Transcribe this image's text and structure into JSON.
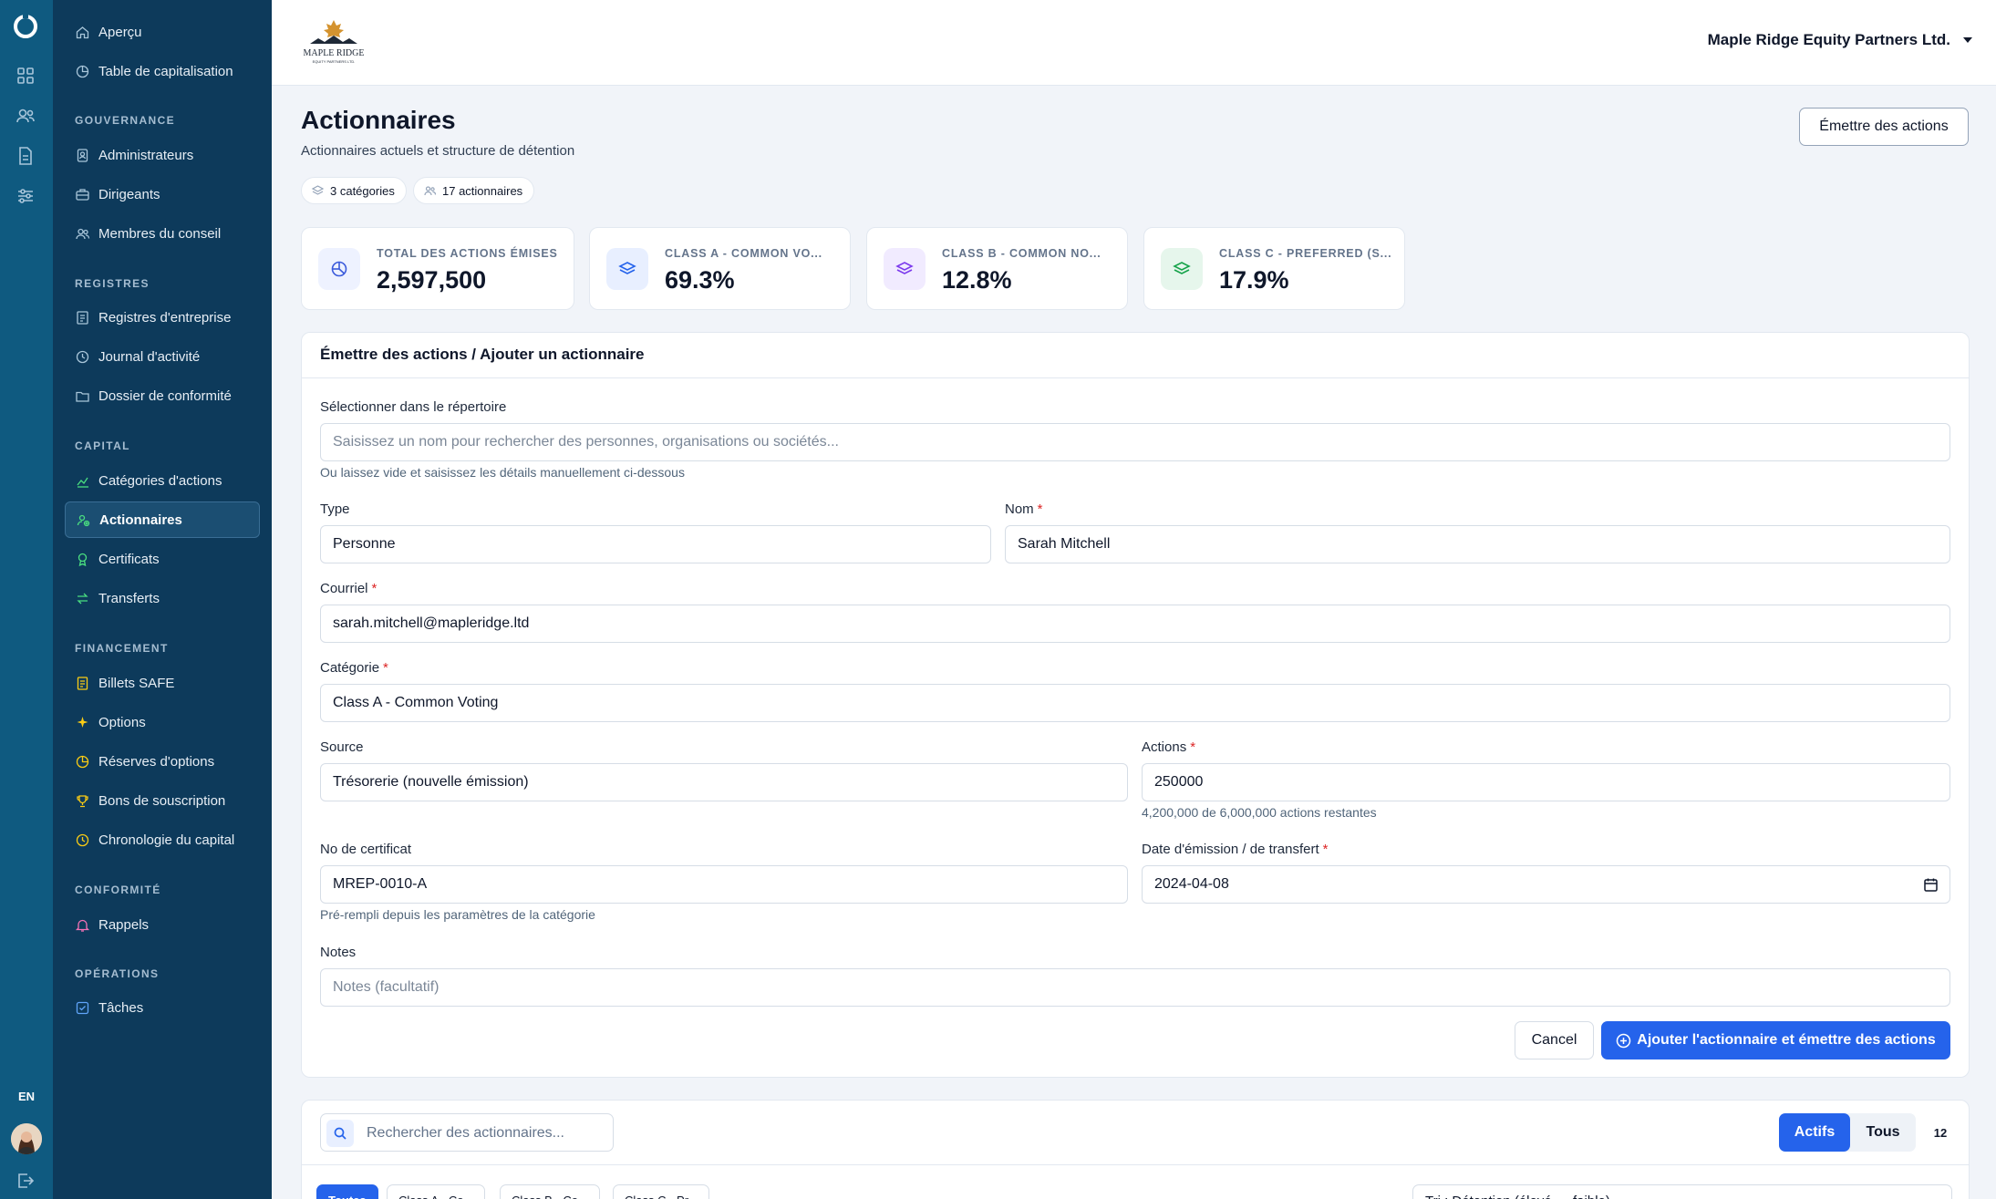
{
  "rail": {
    "lang": "EN",
    "icons": [
      "logo-icon",
      "grid-icon",
      "users-icon",
      "document-icon",
      "sliders-icon",
      "logout-icon"
    ]
  },
  "sidebar": {
    "top": [
      {
        "label": "Aperçu",
        "icon": "home-icon"
      },
      {
        "label": "Table de capitalisation",
        "icon": "pie-icon"
      }
    ],
    "sections": [
      {
        "heading": "GOUVERNANCE",
        "items": [
          {
            "label": "Administrateurs",
            "icon": "badge-icon"
          },
          {
            "label": "Dirigeants",
            "icon": "briefcase-icon"
          },
          {
            "label": "Membres du conseil",
            "icon": "group-icon"
          }
        ]
      },
      {
        "heading": "REGISTRES",
        "items": [
          {
            "label": "Registres d'entreprise",
            "icon": "register-icon"
          },
          {
            "label": "Journal d'activité",
            "icon": "clock-icon"
          },
          {
            "label": "Dossier de conformité",
            "icon": "folder-icon"
          }
        ]
      },
      {
        "heading": "CAPITAL",
        "items": [
          {
            "label": "Catégories d'actions",
            "icon": "chart-icon"
          },
          {
            "label": "Actionnaires",
            "icon": "shareholders-icon",
            "active": true
          },
          {
            "label": "Certificats",
            "icon": "award-icon"
          },
          {
            "label": "Transferts",
            "icon": "transfer-icon"
          }
        ]
      },
      {
        "heading": "FINANCEMENT",
        "items": [
          {
            "label": "Billets SAFE",
            "icon": "note-icon"
          },
          {
            "label": "Options",
            "icon": "sparkle-icon"
          },
          {
            "label": "Réserves d'options",
            "icon": "pie-icon"
          },
          {
            "label": "Bons de souscription",
            "icon": "trophy-icon"
          },
          {
            "label": "Chronologie du capital",
            "icon": "clock-icon"
          }
        ]
      },
      {
        "heading": "CONFORMITÉ",
        "items": [
          {
            "label": "Rappels",
            "icon": "bell-icon"
          }
        ]
      },
      {
        "heading": "OPÉRATIONS",
        "items": [
          {
            "label": "Tâches",
            "icon": "checkbox-icon"
          }
        ]
      }
    ]
  },
  "topbar": {
    "logo_text": "MAPLE RIDGE",
    "logo_subtext": "EQUITY PARTNERS LTD.",
    "org_name": "Maple Ridge Equity Partners Ltd."
  },
  "page": {
    "title": "Actionnaires",
    "subtitle": "Actionnaires actuels et structure de détention",
    "pills": [
      "3 catégories",
      "17 actionnaires"
    ],
    "emit_button": "Émettre des actions"
  },
  "stats": [
    {
      "label": "TOTAL DES ACTIONS ÉMISES",
      "value": "2,597,500",
      "color": "#3b5bdb",
      "bg": "#eef2ff"
    },
    {
      "label": "CLASS A - COMMON VO...",
      "value": "69.3%",
      "color": "#2563eb",
      "bg": "#e8efff"
    },
    {
      "label": "CLASS B - COMMON NO...",
      "value": "12.8%",
      "color": "#7c3aed",
      "bg": "#f1ebff"
    },
    {
      "label": "CLASS C - PREFERRED (S...",
      "value": "17.9%",
      "color": "#16a34a",
      "bg": "#e6f6ec"
    }
  ],
  "form": {
    "heading": "Émettre des actions / Ajouter un actionnaire",
    "directory_label": "Sélectionner dans le répertoire",
    "directory_placeholder": "Saisissez un nom pour rechercher des personnes, organisations ou sociétés...",
    "directory_hint": "Ou laissez vide et saisissez les détails manuellement ci-dessous",
    "type_label": "Type",
    "type_value": "Personne",
    "name_label": "Nom",
    "name_value": "Sarah Mitchell",
    "email_label": "Courriel",
    "email_value": "sarah.mitchell@mapleridge.ltd",
    "category_label": "Catégorie",
    "category_value": "Class A - Common Voting",
    "source_label": "Source",
    "source_value": "Trésorerie (nouvelle émission)",
    "shares_label": "Actions",
    "shares_value": "250000",
    "shares_hint": "4,200,000 de 6,000,000 actions restantes",
    "cert_label": "No de certificat",
    "cert_value": "MREP-0010-A",
    "cert_hint": "Pré-rempli depuis les paramètres de la catégorie",
    "date_label": "Date d'émission / de transfert",
    "date_value": "2024-04-08",
    "notes_label": "Notes",
    "notes_placeholder": "Notes (facultatif)",
    "required_mark": "*",
    "cancel": "Cancel",
    "submit": "Ajouter l'actionnaire et émettre des actions"
  },
  "list": {
    "search_placeholder": "Rechercher des actionnaires...",
    "toggle_active": "Actifs",
    "toggle_all": "Tous",
    "count": "12",
    "chips": [
      "Toutes",
      "Class A - Co...",
      "Class B - Co...",
      "Class C - Pr..."
    ],
    "sort": "Tri : Détention (élevé → faible)"
  }
}
